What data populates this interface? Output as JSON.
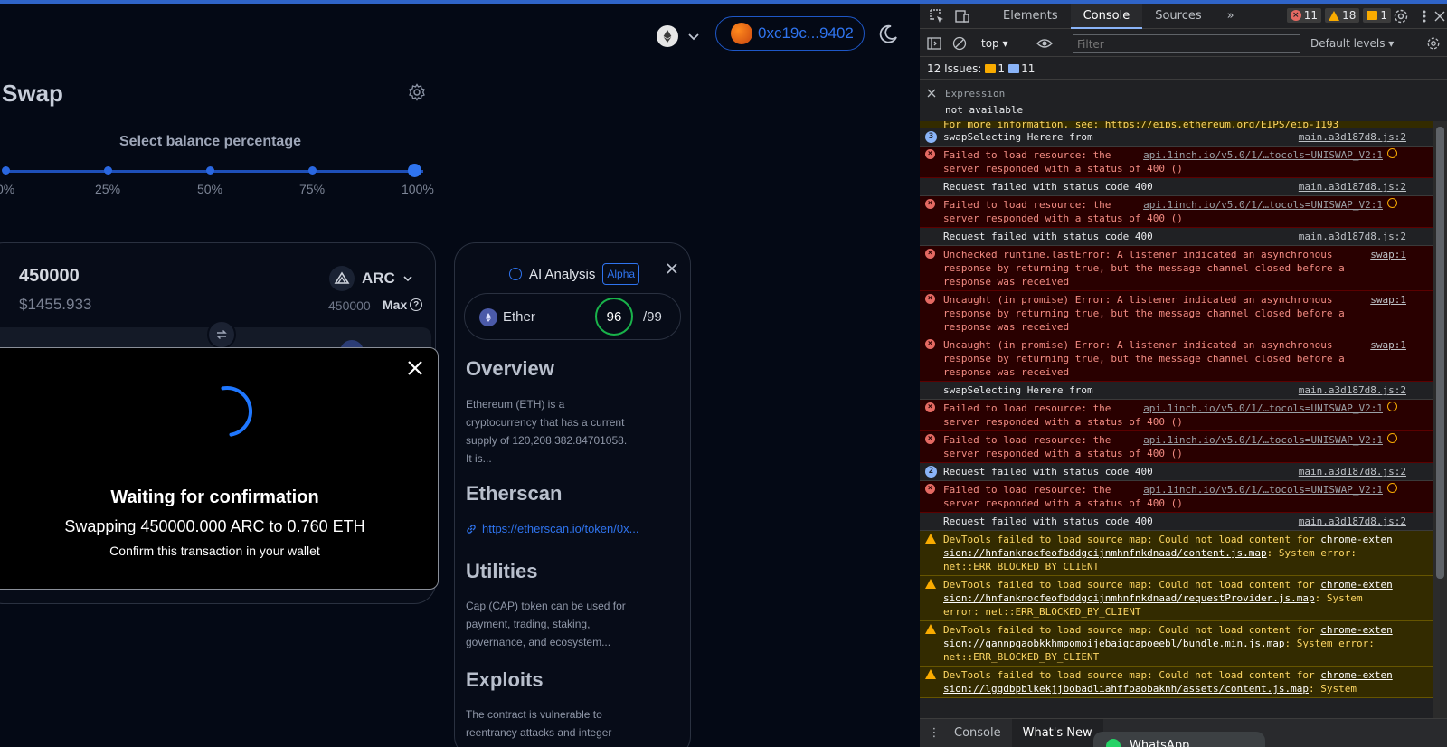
{
  "header": {
    "network_icon": "ethereum-icon",
    "wallet_address": "0xc19c...9402"
  },
  "swap": {
    "title": "Swap",
    "balance_label": "Select balance percentage",
    "percent_options": [
      "0%",
      "25%",
      "50%",
      "75%",
      "100%"
    ],
    "selected_percent": 100,
    "from": {
      "amount": "450000",
      "usd_value": "$1455.933",
      "token": "ARC",
      "balance": "450000",
      "max_label": "Max"
    }
  },
  "modal": {
    "title": "Waiting for confirmation",
    "subtitle": "Swapping 450000.000 ARC to 0.760 ETH",
    "note": "Confirm this transaction in your wallet"
  },
  "ai": {
    "title": "AI Analysis",
    "badge": "Alpha",
    "token": "Ether",
    "score": "96",
    "score_max": "/99",
    "overview_title": "Overview",
    "overview_text": "Ethereum (ETH) is a cryptocurrency that has a current supply of 120,208,382.84701058. It is...",
    "etherscan_title": "Etherscan",
    "etherscan_link": "https://etherscan.io/token/0x...",
    "utilities_title": "Utilities",
    "utilities_text": "Cap (CAP) token can be used for payment, trading, staking, governance, and ecosystem...",
    "exploits_title": "Exploits",
    "exploits_text": "The contract is vulnerable to reentrancy attacks and integer"
  },
  "devtools": {
    "tabs": [
      "Elements",
      "Console",
      "Sources"
    ],
    "active_tab": "Console",
    "error_count": "11",
    "warning_count": "18",
    "info_count": "1",
    "context": "top",
    "filter_placeholder": "Filter",
    "levels": "Default levels",
    "issues_label": "12 Issues:",
    "issues_warn": "1",
    "issues_info": "11",
    "expression_label": "Expression",
    "expression_value": "not available",
    "log": [
      {
        "type": "warn-cut",
        "text": "For more information, see: https://eips.ethereum.org/EIPS/eip-1193"
      },
      {
        "type": "log",
        "count": "3",
        "text": "swapSelecting Herere  from",
        "src": "main.a3d187d8.js:2"
      },
      {
        "type": "error",
        "text": "Failed to load resource: the server responded with a status of 400 ()",
        "url": "api.1inch.io/v5.0/1/…tocols=UNISWAP_V2:1"
      },
      {
        "type": "log",
        "text": "Request failed with status code 400",
        "src": "main.a3d187d8.js:2"
      },
      {
        "type": "error",
        "text": "Failed to load resource: the server responded with a status of 400 ()",
        "url": "api.1inch.io/v5.0/1/…tocols=UNISWAP_V2:1"
      },
      {
        "type": "log",
        "text": "Request failed with status code 400",
        "src": "main.a3d187d8.js:2"
      },
      {
        "type": "error",
        "text": "Unchecked runtime.lastError: A listener indicated an asynchronous response by returning true, but the message channel closed before a response was received",
        "src": "swap:1"
      },
      {
        "type": "error",
        "text": "Uncaught (in promise) Error: A listener indicated an asynchronous response by returning true, but the message channel closed before a response was received",
        "src": "swap:1"
      },
      {
        "type": "error",
        "text": "Uncaught (in promise) Error: A listener indicated an asynchronous response by returning true, but the message channel closed before a response was received",
        "src": "swap:1"
      },
      {
        "type": "log",
        "text": "swapSelecting Herere  from",
        "src": "main.a3d187d8.js:2"
      },
      {
        "type": "error",
        "text": "Failed to load resource: the server responded with a status of 400 ()",
        "url": "api.1inch.io/v5.0/1/…tocols=UNISWAP_V2:1"
      },
      {
        "type": "error",
        "text": "Failed to load resource: the server responded with a status of 400 ()",
        "url": "api.1inch.io/v5.0/1/…tocols=UNISWAP_V2:1"
      },
      {
        "type": "log",
        "count": "2",
        "text": "Request failed with status code 400",
        "src": "main.a3d187d8.js:2"
      },
      {
        "type": "error",
        "text": "Failed to load resource: the server responded with a status of 400 ()",
        "url": "api.1inch.io/v5.0/1/…tocols=UNISWAP_V2:1"
      },
      {
        "type": "log",
        "text": "Request failed with status code 400",
        "src": "main.a3d187d8.js:2"
      },
      {
        "type": "warn",
        "pre": "DevTools failed to load source map: Could not load content for ",
        "link": "chrome-extension://hnfanknocfeofbddgcijnmhnfnkdnaad/content.js.map",
        "post": ": System error: net::ERR_BLOCKED_BY_CLIENT"
      },
      {
        "type": "warn",
        "pre": "DevTools failed to load source map: Could not load content for ",
        "link": "chrome-extension://hnfanknocfeofbddgcijnmhnfnkdnaad/requestProvider.js.map",
        "post": ": System error: net::ERR_BLOCKED_BY_CLIENT"
      },
      {
        "type": "warn",
        "pre": "DevTools failed to load source map: Could not load content for ",
        "link": "chrome-extension://gannpgaobkkhmpomoijebaigcapoeebl/bundle.min.js.map",
        "post": ": System error: net::ERR_BLOCKED_BY_CLIENT"
      },
      {
        "type": "warn",
        "pre": "DevTools failed to load source map: Could not load content for ",
        "link": "chrome-extension://lggdbpblkekjjbobadliahffoaobaknh/assets/content.js.map",
        "post": ": System"
      }
    ],
    "drawer_tabs": [
      "Console",
      "What's New"
    ],
    "drawer_active": "What's New",
    "toast": "WhatsApp"
  }
}
